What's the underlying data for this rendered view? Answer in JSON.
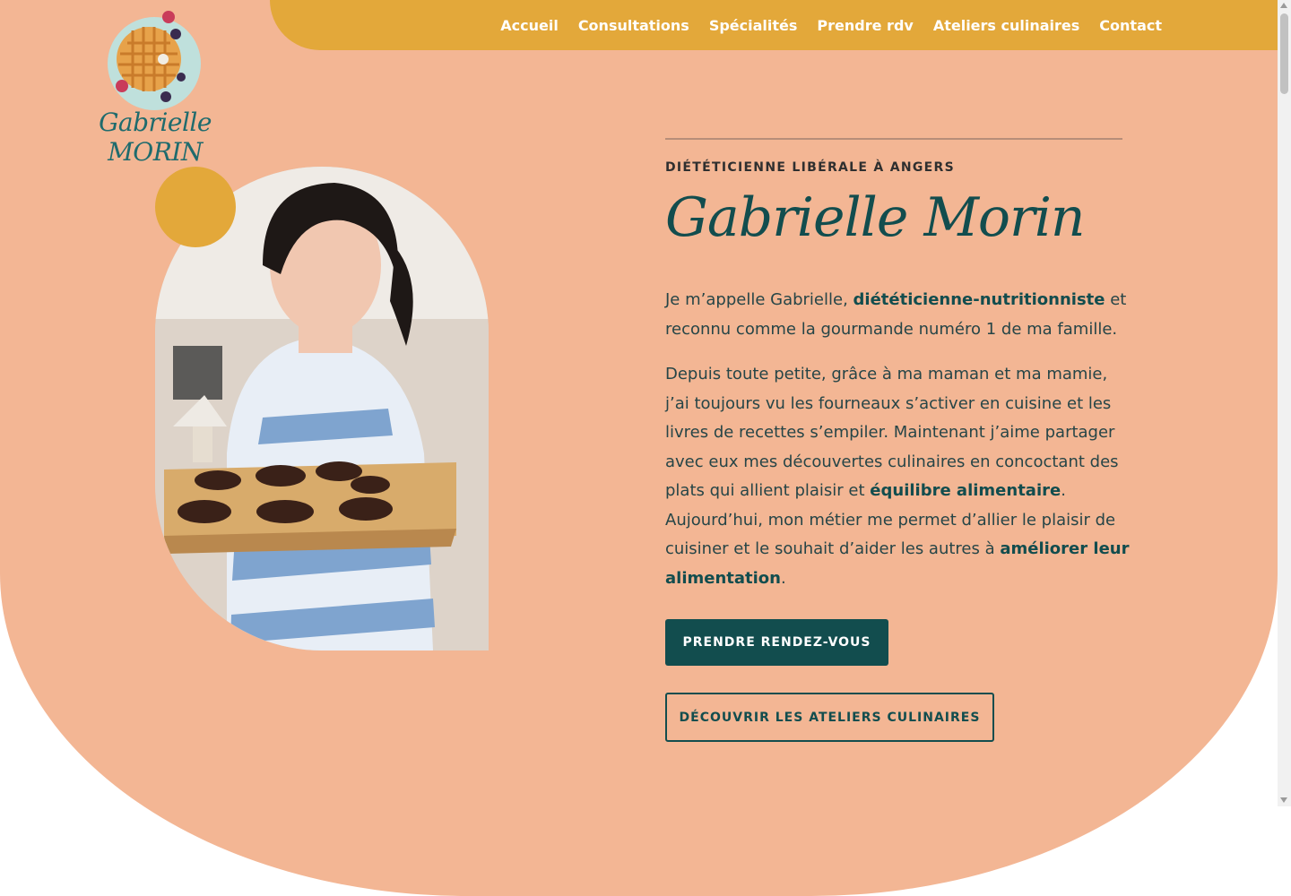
{
  "nav": {
    "items": [
      "Accueil",
      "Consultations",
      "Spécialités",
      "Prendre rdv",
      "Ateliers culinaires",
      "Contact"
    ]
  },
  "logo": {
    "text": "Gabrielle MORIN"
  },
  "hero": {
    "eyebrow": "DIÉTÉTICIENNE LIBÉRALE À ANGERS",
    "name": "Gabrielle Morin",
    "p1_a": "Je m’appelle Gabrielle, ",
    "p1_b": "diététicienne-nutritionniste",
    "p1_c": " et reconnu comme la gourmande numéro 1 de ma famille.",
    "p2_a": "Depuis toute petite, grâce à ma maman et ma mamie, j’ai toujours vu les fourneaux s’activer en cuisine et les livres de recettes s’empiler. Maintenant j’aime partager avec eux mes découvertes culinaires en concoctant des plats qui allient plaisir et ",
    "p2_b": "équilibre alimentaire",
    "p2_c": ".",
    "p3_a": "Aujourd’hui, mon métier me permet d’allier le plaisir de cuisiner et le souhait d’aider les autres à ",
    "p3_b": "améliorer leur alimentation",
    "p3_c": ".",
    "btn_primary": "PRENDRE RENDEZ-VOUS",
    "btn_secondary": "DÉCOUVRIR LES ATELIERS CULINAIRES"
  },
  "colors": {
    "hero_bg": "#f3b694",
    "nav_bg": "#e3a83a",
    "accent_dark": "#124d4e",
    "accent_yellow": "#e3a83a"
  }
}
